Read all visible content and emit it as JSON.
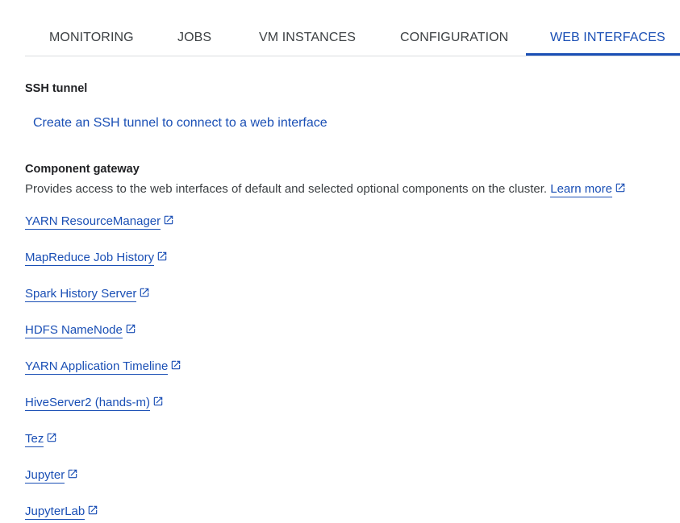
{
  "tabs": [
    {
      "label": "MONITORING"
    },
    {
      "label": "JOBS"
    },
    {
      "label": "VM INSTANCES"
    },
    {
      "label": "CONFIGURATION"
    },
    {
      "label": "WEB INTERFACES",
      "active": true
    }
  ],
  "ssh": {
    "title": "SSH tunnel",
    "link_label": "Create an SSH tunnel to connect to a web interface"
  },
  "gateway": {
    "title": "Component gateway",
    "description": "Provides access to the web interfaces of default and selected optional components on the cluster.",
    "learn_more": "Learn more",
    "links": [
      {
        "label": "YARN ResourceManager",
        "icon": "open-in-new-icon"
      },
      {
        "label": "MapReduce Job History",
        "icon": "open-in-new-icon"
      },
      {
        "label": "Spark History Server",
        "icon": "open-in-new-icon"
      },
      {
        "label": "HDFS NameNode",
        "icon": "open-in-new-icon"
      },
      {
        "label": "YARN Application Timeline",
        "icon": "open-in-new-icon"
      },
      {
        "label": "HiveServer2 (hands-m)",
        "icon": "open-in-new-icon"
      },
      {
        "label": "Tez",
        "icon": "open-in-new-icon"
      },
      {
        "label": "Jupyter",
        "icon": "open-in-new-icon"
      },
      {
        "label": "JupyterLab",
        "icon": "open-in-new-icon"
      }
    ]
  },
  "colors": {
    "accent": "#1a4fb5",
    "text": "#202124",
    "divider": "#dadce0"
  }
}
